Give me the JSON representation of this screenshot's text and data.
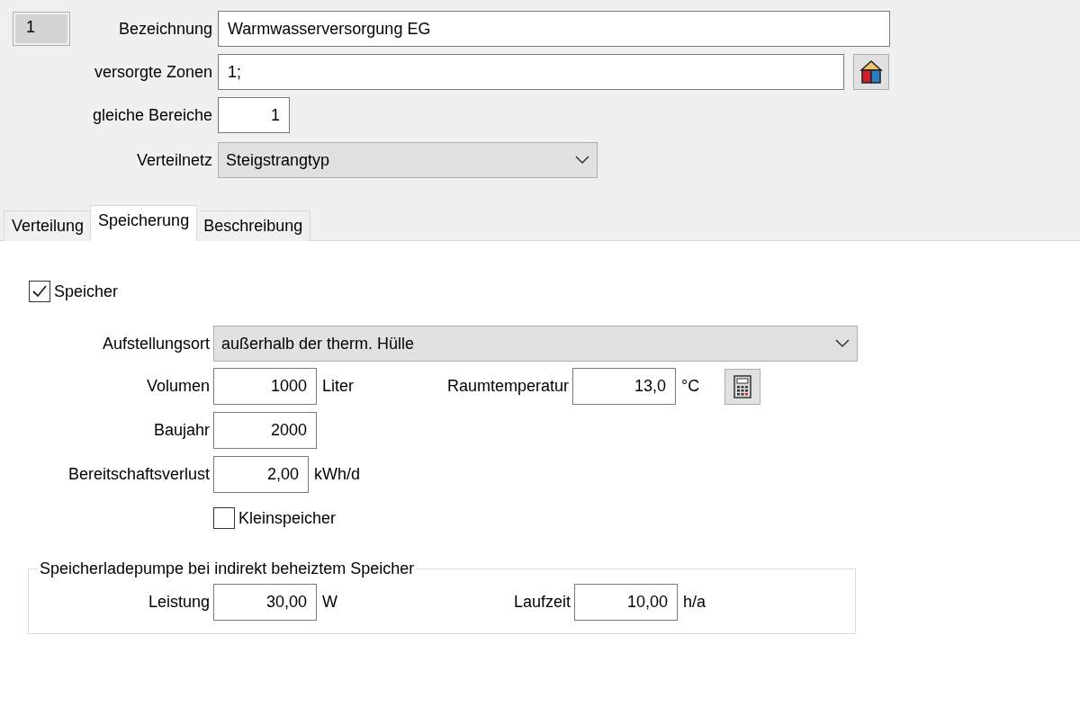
{
  "record_number": "1",
  "fields": [
    {
      "label": "Bezeichnung",
      "value": "Warmwasserversorgung EG",
      "kind": "text"
    },
    {
      "label": "versorgte Zonen",
      "value": "1;",
      "kind": "zones"
    },
    {
      "label": "gleiche Bereiche",
      "value": "1",
      "kind": "number"
    },
    {
      "label": "Verteilnetz",
      "value": "Steigstrangtyp",
      "kind": "select"
    }
  ],
  "tabs": [
    {
      "label": "Verteilung",
      "selected": false
    },
    {
      "label": "Speicherung",
      "selected": true
    },
    {
      "label": "Beschreibung",
      "selected": false
    }
  ],
  "storage": {
    "checkbox": {
      "label": "Speicher",
      "checked": true
    },
    "location": {
      "label": "Aufstellungsort",
      "value": "außerhalb der therm. Hülle"
    },
    "rows": [
      {
        "fields": [
          {
            "label": "Volumen",
            "value": "1000",
            "unit": "Liter"
          },
          {
            "label": "Raumtemperatur",
            "value": "13,0",
            "unit": "°C",
            "has_calculator": true
          }
        ]
      },
      {
        "fields": [
          {
            "label": "Baujahr",
            "value": "2000"
          }
        ]
      },
      {
        "fields": [
          {
            "label": "Bereitschaftsverlust",
            "value": "2,00",
            "unit": "kWh/d"
          }
        ]
      }
    ],
    "small_storage": {
      "label": "Kleinspeicher",
      "checked": false
    },
    "pump_group": {
      "title": "Speicherladepumpe bei indirekt beheiztem Speicher",
      "fields": [
        {
          "label": "Leistung",
          "value": "30,00",
          "unit": "W"
        },
        {
          "label": "Laufzeit",
          "value": "10,00",
          "unit": "h/a"
        }
      ]
    }
  }
}
